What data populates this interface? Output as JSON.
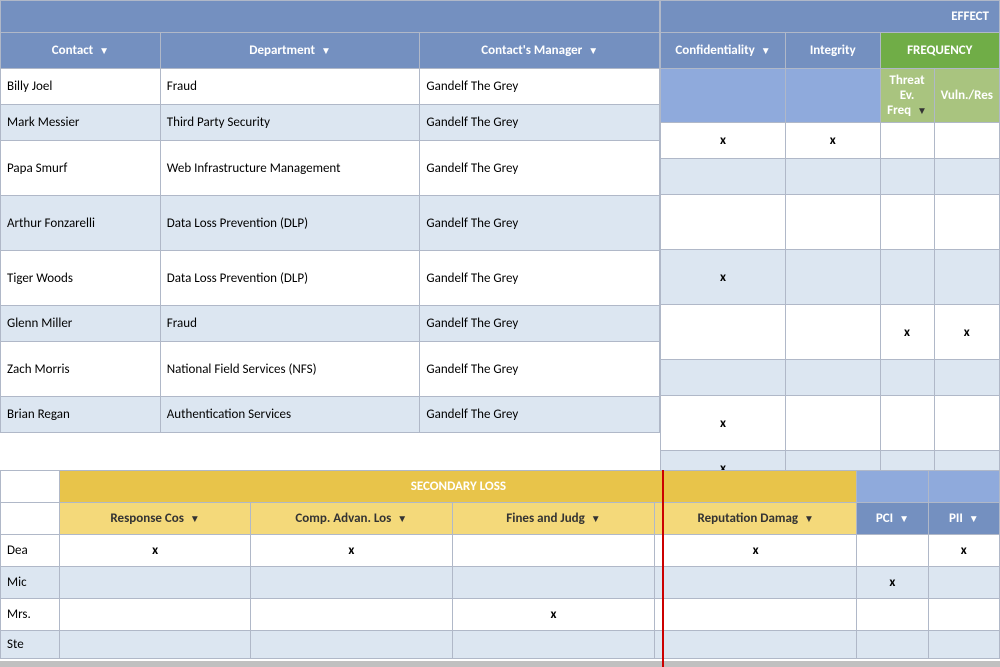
{
  "effect": {
    "title": "EFFECT",
    "confidentiality": "Confidentiality",
    "integrity": "Integrity"
  },
  "frequency": {
    "title": "FREQUENCY",
    "threat_ev": "Threat Ev. Freq",
    "vuln_res": "Vuln./Res"
  },
  "secondary_loss": {
    "title": "SECONDARY LOSS",
    "response_cost": "Response Cos",
    "comp_advan": "Comp. Advan. Los",
    "fines": "Fines and Judg",
    "reputation": "Reputation Damag",
    "pci": "PCI",
    "pii": "PII"
  },
  "main_headers": {
    "contact": "Contact",
    "department": "Department",
    "contact_manager": "Contact's Manager"
  },
  "main_rows": [
    {
      "contact": "Billy Joel",
      "department": "Fraud",
      "manager": "Gandelf The Grey",
      "confidentiality": "x",
      "integrity": "x"
    },
    {
      "contact": "Mark Messier",
      "department": "Third Party Security",
      "manager": "Gandelf The Grey",
      "confidentiality": "",
      "integrity": ""
    },
    {
      "contact": "Papa Smurf",
      "department": "Web Infrastructure Management",
      "manager": "Gandelf The Grey",
      "confidentiality": "",
      "integrity": ""
    },
    {
      "contact": "Arthur Fonzarelli",
      "department": "Data Loss Prevention (DLP)",
      "manager": "Gandelf The Grey",
      "confidentiality": "x",
      "integrity": "",
      "threat_freq": "",
      "vuln": ""
    },
    {
      "contact": "Tiger Woods",
      "department": "Data Loss Prevention (DLP)",
      "manager": "Gandelf The Grey",
      "confidentiality": "",
      "integrity": "",
      "threat_freq": "x",
      "vuln": "x"
    },
    {
      "contact": "Glenn Miller",
      "department": "Fraud",
      "manager": "Gandelf The Grey",
      "confidentiality": "",
      "integrity": "",
      "threat_freq": "",
      "vuln": ""
    },
    {
      "contact": "Zach Morris",
      "department": "National Field Services (NFS)",
      "manager": "Gandelf The Grey",
      "confidentiality": "x",
      "integrity": "",
      "threat_freq": "",
      "vuln": ""
    },
    {
      "contact": "Brian Regan",
      "department": "Authentication Services",
      "manager": "Gandelf The Grey",
      "confidentiality": "x",
      "integrity": "",
      "threat_freq": "",
      "vuln": ""
    }
  ],
  "bottom_partial": [
    {
      "name": "Dea",
      "response": "x",
      "comp_advan": "x",
      "fines": "",
      "reputation": "x",
      "pci": "",
      "pii": "x"
    },
    {
      "name": "Mic",
      "response": "",
      "comp_advan": "",
      "fines": "",
      "reputation": "",
      "pci": "x",
      "pii": ""
    },
    {
      "name": "Mrs.",
      "response": "",
      "comp_advan": "",
      "fines": "x",
      "reputation": "",
      "pci": "",
      "pii": ""
    },
    {
      "name": "Ste",
      "response": "",
      "comp_advan": "",
      "fines": "",
      "reputation": "",
      "pci": "",
      "pii": ""
    }
  ]
}
